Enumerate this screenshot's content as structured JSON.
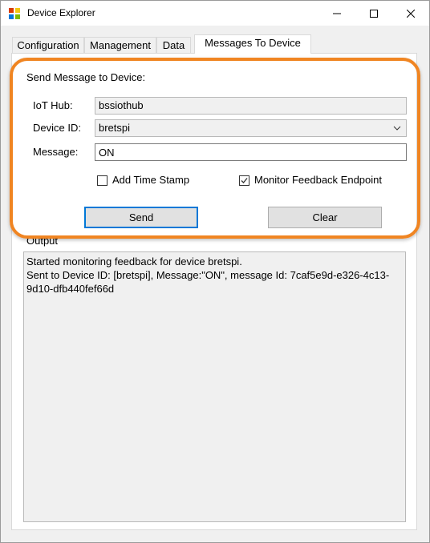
{
  "window": {
    "title": "Device Explorer"
  },
  "tabs": [
    {
      "label": "Configuration"
    },
    {
      "label": "Management"
    },
    {
      "label": "Data"
    },
    {
      "label": "Messages To Device"
    }
  ],
  "send_group": {
    "title": "Send Message to Device:",
    "iot_hub_label": "IoT Hub:",
    "iot_hub_value": "bssiothub",
    "device_id_label": "Device ID:",
    "device_id_value": "bretspi",
    "message_label": "Message:",
    "message_value": "ON",
    "add_timestamp_label": "Add Time Stamp",
    "add_timestamp_checked": false,
    "monitor_feedback_label": "Monitor Feedback Endpoint",
    "monitor_feedback_checked": true,
    "send_label": "Send",
    "clear_label": "Clear"
  },
  "output": {
    "label": "Output",
    "lines": [
      "Started monitoring feedback for device bretspi.",
      "Sent to Device ID: [bretspi], Message:\"ON\", message Id: 7caf5e9d-e326-4c13-",
      "9d10-dfb440fef66d"
    ]
  },
  "colors": {
    "highlight": "#f08522",
    "default_button_border": "#0078d7"
  }
}
